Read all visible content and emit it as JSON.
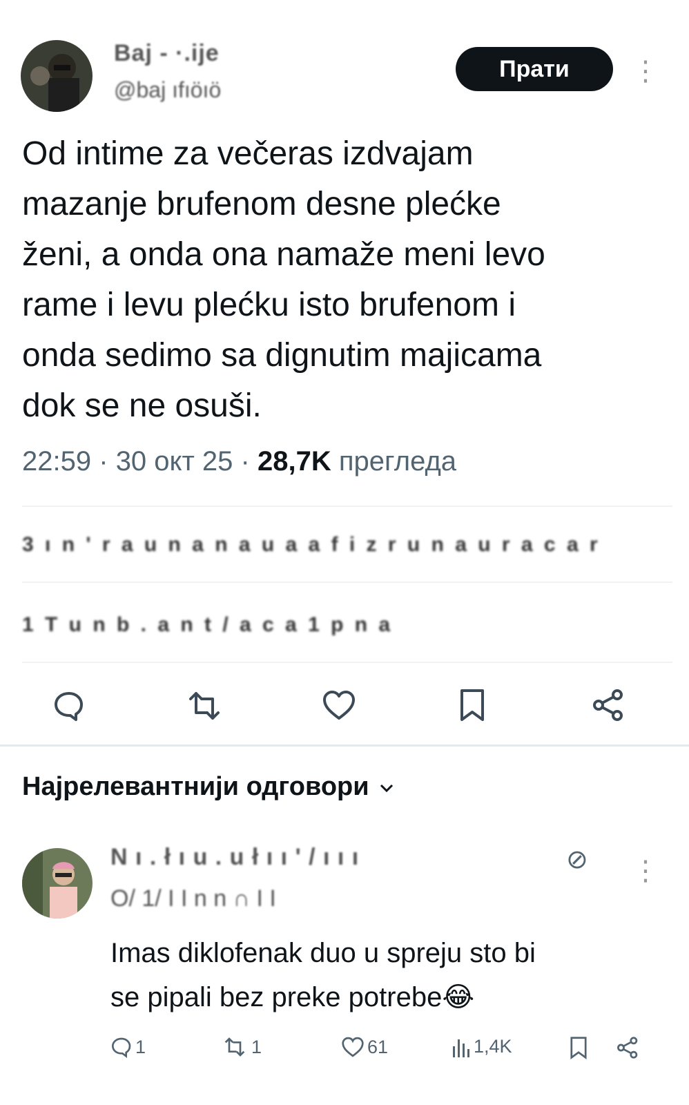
{
  "tweet": {
    "author_name": "Baj  - ·.ije",
    "author_handle": "@baj      ıfıöıö",
    "follow_label": "Прати",
    "more_label": "⋮",
    "text_lines": [
      "Od intime za večeras izdvajam",
      "mazanje brufenom desne plećke",
      "ženi, a onda ona namaže meni levo",
      "rame i levu plećku isto brufenom i",
      "onda sedimo sa dignutim majicama",
      "dok se ne osuši."
    ],
    "time": "22:59",
    "sep": "·",
    "date": "30 окт 25",
    "views": "28,7K",
    "views_label": "прегледа",
    "stats_line_1": "3 ı n ' r a u n a n  a u a  a f i z  r  u n a  u  r  a  c a r",
    "stats_line_2": "1 T   u n  b   . a n  t / a   c a  1  p   n a"
  },
  "actions": {
    "reply_icon": "reply-icon",
    "retweet_icon": "retweet-icon",
    "like_icon": "heart-icon",
    "bookmark_icon": "bookmark-icon",
    "share_icon": "share-icon"
  },
  "replies_section": {
    "title": "Најрелевантнији одговори",
    "chevron": "⌄"
  },
  "reply": {
    "author_name": "N  ı . ł  ı u  . u ł  ı ı '  / ı  ı  ı",
    "author_handle": "O/  1/ I I  n   n  ∩  I I",
    "verified_glyph": "⊘",
    "more_label": "⋮",
    "text_lines": [
      "Imas diklofenak duo u spreju sto bi",
      "se pipali bez preke potrebe"
    ],
    "emoji": "😂",
    "reply_count": "1",
    "retweet_count": "1",
    "like_count": "61",
    "views_count": "1,4K"
  },
  "colors": {
    "text": "#0f1419",
    "secondary": "#536471",
    "divider": "#eff3f4",
    "button_bg": "#0f1419"
  }
}
